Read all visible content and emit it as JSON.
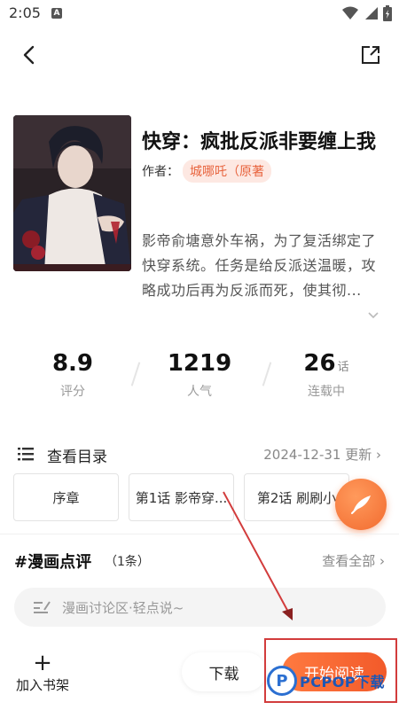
{
  "status_bar": {
    "time": "2:05",
    "notification_icon": "A"
  },
  "header": {
    "back_icon": "chevron-left-icon",
    "share_icon": "share-external-icon"
  },
  "comic": {
    "title": "快穿：疯批反派非要缠上我",
    "author_label": "作者：",
    "author_name": "城哪吒（原著",
    "description": "影帝俞塘意外车祸，为了复活绑定了快穿系统。任务是给反派送温暖，攻略成功后再为反派而死，使其彻...",
    "stats": {
      "score": {
        "value": "8.9",
        "label": "评分"
      },
      "popularity": {
        "value": "1219",
        "label": "人气"
      },
      "episodes": {
        "value": "26",
        "unit": "话",
        "label": "连载中"
      }
    }
  },
  "catalog": {
    "label": "查看目录",
    "update": "2024-12-31 更新",
    "chapters": [
      "序章",
      "第1话 影帝穿...",
      "第2话 刷刷小"
    ]
  },
  "reviews": {
    "title": "#漫画点评",
    "count": "（1条）",
    "view_all": "查看全部",
    "input_placeholder": "漫画讨论区·轻点说~"
  },
  "bottom_bar": {
    "add_shelf_label": "加入书架",
    "download_label": "下载",
    "start_read_label": "开始阅读"
  },
  "watermark": {
    "brand": "PCPOP",
    "brand_suffix": "下载",
    "logo_letter": "P"
  },
  "colors": {
    "accent": "#f26b2f",
    "author_tag_bg": "#fde8e2",
    "highlight": "#d23c3c"
  }
}
